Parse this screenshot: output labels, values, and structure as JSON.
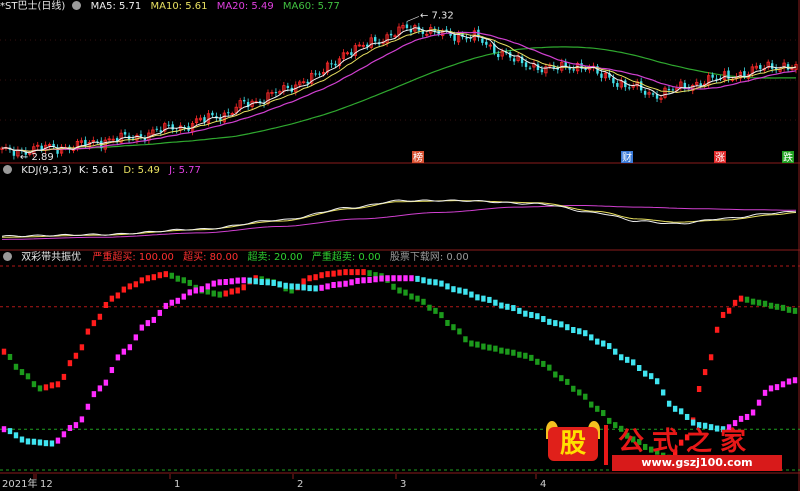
{
  "header_main": {
    "stock_name": "*ST巴士(日线)",
    "ma5_label": "MA5: 5.71",
    "ma10_label": "MA10: 5.61",
    "ma20_label": "MA20: 5.49",
    "ma60_label": "MA60: 5.77"
  },
  "header_kdj": {
    "title": "KDJ(9,3,3)",
    "k_label": "K: 5.61",
    "d_label": "D: 5.49",
    "j_label": "J: 5.77"
  },
  "header_osc": {
    "title": "双彩带共振优",
    "item1": "严重超买: 100.00",
    "item2": "超买: 80.00",
    "item3": "超卖: 20.00",
    "item4": "严重超卖: 0.00",
    "item5": "股票下载网: 0.00"
  },
  "colors": {
    "up": "#ff2a2a",
    "down": "#43e0ea",
    "ma5": "#f0f0f0",
    "ma10": "#e8e060",
    "ma20": "#d040d0",
    "ma60": "#2fa82f",
    "k": "#f0f0f0",
    "d": "#e8e060",
    "j": "#d040d0",
    "band_red": "#ff1c1c",
    "band_magenta": "#ff2cff",
    "band_cyan": "#40e4f0",
    "band_green": "#1c9a1c",
    "ref_red": "#b01818",
    "ref_green": "#20a020"
  },
  "chart_data": {
    "type": "candlestick",
    "symbol": "*ST巴士",
    "period": "日线",
    "price_ylim": [
      2.6,
      7.6
    ],
    "high_marker": "7.32",
    "low_marker": "2.89",
    "time_labels": [
      "2021年",
      "12",
      "1",
      "2",
      "3",
      "4"
    ],
    "events": [
      {
        "label": "榜",
        "color": "#d85030"
      },
      {
        "label": "财",
        "color": "#3a7ad8"
      },
      {
        "label": "涨",
        "color": "#e02828"
      },
      {
        "label": "跌",
        "color": "#20a020"
      }
    ],
    "series": [
      {
        "name": "MA5",
        "value_label": "5.71"
      },
      {
        "name": "MA10",
        "value_label": "5.61"
      },
      {
        "name": "MA20",
        "value_label": "5.49"
      },
      {
        "name": "MA60",
        "value_label": "5.77"
      }
    ],
    "close_anchors": [
      [
        0,
        2.95
      ],
      [
        15,
        3.1
      ],
      [
        30,
        3.4
      ],
      [
        45,
        3.8
      ],
      [
        55,
        4.2
      ],
      [
        62,
        4.6
      ],
      [
        70,
        5.0
      ],
      [
        78,
        5.5
      ],
      [
        88,
        6.4
      ],
      [
        95,
        6.8
      ],
      [
        103,
        7.2
      ],
      [
        110,
        7.0
      ],
      [
        118,
        6.9
      ],
      [
        125,
        6.4
      ],
      [
        132,
        5.9
      ],
      [
        140,
        5.8
      ],
      [
        146,
        5.9
      ],
      [
        152,
        5.5
      ],
      [
        158,
        5.2
      ],
      [
        164,
        4.9
      ],
      [
        170,
        5.1
      ],
      [
        178,
        5.4
      ],
      [
        186,
        5.6
      ],
      [
        194,
        5.9
      ],
      [
        200,
        5.8
      ]
    ],
    "kdj_ylim": [
      -10,
      120
    ],
    "kdj_anchors": {
      "K": [
        [
          0,
          12
        ],
        [
          25,
          15
        ],
        [
          50,
          25
        ],
        [
          70,
          42
        ],
        [
          88,
          65
        ],
        [
          100,
          78
        ],
        [
          115,
          78
        ],
        [
          135,
          72
        ],
        [
          150,
          55
        ],
        [
          160,
          40
        ],
        [
          170,
          35
        ],
        [
          182,
          45
        ],
        [
          195,
          55
        ],
        [
          200,
          58
        ]
      ],
      "D": [
        [
          0,
          10
        ],
        [
          25,
          14
        ],
        [
          50,
          24
        ],
        [
          70,
          40
        ],
        [
          88,
          63
        ],
        [
          100,
          76
        ],
        [
          115,
          78
        ],
        [
          135,
          74
        ],
        [
          150,
          58
        ],
        [
          160,
          44
        ],
        [
          170,
          38
        ],
        [
          182,
          42
        ],
        [
          195,
          52
        ],
        [
          200,
          56
        ]
      ],
      "J": [
        [
          0,
          6
        ],
        [
          25,
          10
        ],
        [
          50,
          18
        ],
        [
          70,
          30
        ],
        [
          90,
          44
        ],
        [
          110,
          56
        ],
        [
          130,
          66
        ],
        [
          145,
          69
        ],
        [
          160,
          66
        ],
        [
          175,
          63
        ],
        [
          190,
          61
        ],
        [
          200,
          60
        ]
      ]
    },
    "osc_ylim": [
      0,
      100
    ],
    "osc_levels": [
      100,
      80,
      20,
      0
    ],
    "osc_level_labels": [
      "严重超买",
      "超买",
      "超卖",
      "严重超卖"
    ],
    "osc_fast_anchors": [
      [
        0,
        58
      ],
      [
        3,
        48
      ],
      [
        6,
        40
      ],
      [
        9,
        42
      ],
      [
        12,
        56
      ],
      [
        15,
        72
      ],
      [
        18,
        84
      ],
      [
        21,
        90
      ],
      [
        24,
        94
      ],
      [
        27,
        96
      ],
      [
        30,
        93
      ],
      [
        33,
        88
      ],
      [
        36,
        86
      ],
      [
        39,
        88
      ],
      [
        42,
        94
      ],
      [
        45,
        92
      ],
      [
        48,
        88
      ],
      [
        51,
        94
      ],
      [
        54,
        96
      ],
      [
        57,
        97
      ],
      [
        60,
        97
      ],
      [
        63,
        95
      ],
      [
        66,
        88
      ],
      [
        69,
        84
      ],
      [
        72,
        78
      ],
      [
        75,
        70
      ],
      [
        78,
        62
      ],
      [
        81,
        60
      ],
      [
        84,
        58
      ],
      [
        87,
        56
      ],
      [
        90,
        52
      ],
      [
        93,
        45
      ],
      [
        96,
        38
      ],
      [
        99,
        30
      ],
      [
        102,
        22
      ],
      [
        105,
        15
      ],
      [
        108,
        10
      ],
      [
        111,
        6
      ],
      [
        114,
        16
      ],
      [
        117,
        48
      ],
      [
        120,
        76
      ],
      [
        123,
        84
      ],
      [
        126,
        82
      ],
      [
        129,
        80
      ],
      [
        132,
        78
      ]
    ],
    "osc_slow_anchors": [
      [
        0,
        20
      ],
      [
        4,
        14
      ],
      [
        8,
        13
      ],
      [
        12,
        22
      ],
      [
        16,
        40
      ],
      [
        20,
        58
      ],
      [
        24,
        72
      ],
      [
        28,
        82
      ],
      [
        32,
        88
      ],
      [
        36,
        92
      ],
      [
        40,
        93
      ],
      [
        44,
        92
      ],
      [
        48,
        90
      ],
      [
        52,
        89
      ],
      [
        56,
        91
      ],
      [
        60,
        93
      ],
      [
        64,
        94
      ],
      [
        68,
        94
      ],
      [
        72,
        92
      ],
      [
        76,
        88
      ],
      [
        80,
        84
      ],
      [
        84,
        80
      ],
      [
        88,
        76
      ],
      [
        92,
        72
      ],
      [
        96,
        68
      ],
      [
        100,
        62
      ],
      [
        104,
        54
      ],
      [
        108,
        46
      ],
      [
        112,
        30
      ],
      [
        116,
        22
      ],
      [
        120,
        20
      ],
      [
        124,
        26
      ],
      [
        128,
        40
      ],
      [
        132,
        44
      ]
    ]
  }
}
